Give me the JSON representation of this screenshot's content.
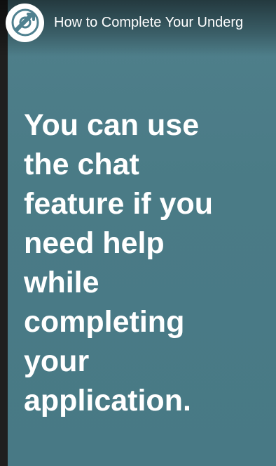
{
  "header": {
    "avatar_icon": "channel-logo-icon",
    "title": "How to Complete Your Underg"
  },
  "caption": {
    "lines": [
      "You can use",
      "the chat",
      "feature if you",
      "need help",
      "while",
      "completing",
      "your",
      "application."
    ]
  },
  "colors": {
    "background": "#4a7b86",
    "frame": "#1f1f1f",
    "text": "#ffffff"
  }
}
